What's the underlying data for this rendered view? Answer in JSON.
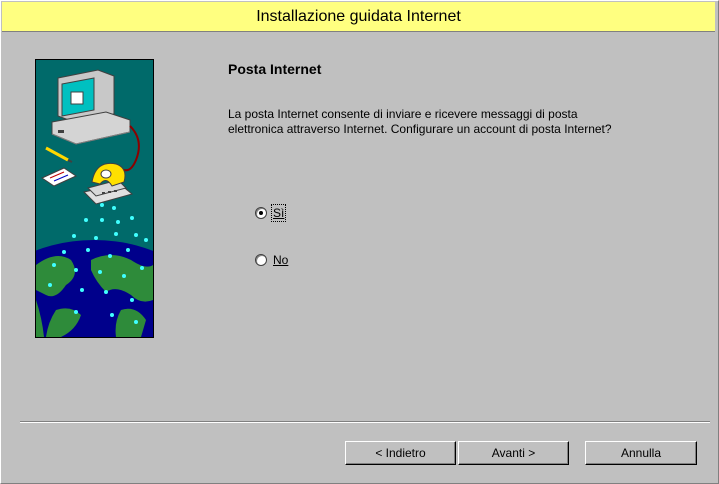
{
  "window": {
    "title": "Installazione guidata Internet"
  },
  "page": {
    "heading": "Posta Internet",
    "description": "La posta Internet consente di inviare e ricevere messaggi di posta elettronica attraverso Internet. Configurare un account di posta Internet?"
  },
  "options": [
    {
      "label": "Sì",
      "selected": true
    },
    {
      "label": "No",
      "selected": false
    }
  ],
  "buttons": {
    "back": "< Indietro",
    "next": "Avanti >",
    "cancel": "Annulla"
  },
  "colors": {
    "title_bar": "#ffff80",
    "dialog": "#c0c0c0",
    "art_background": "#006a6a",
    "art_ocean": "#00008b",
    "art_land": "#2e8b3a"
  },
  "illustration": {
    "icons": [
      "computer-icon",
      "telephone-icon",
      "pencil-icon",
      "notepad-icon",
      "globe-icon"
    ]
  }
}
